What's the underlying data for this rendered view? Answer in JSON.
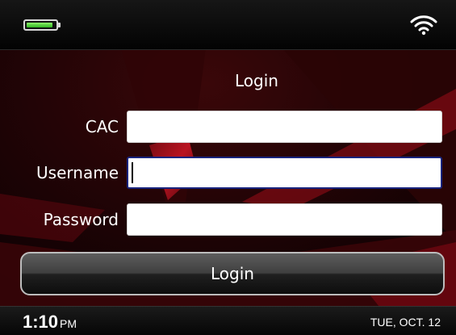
{
  "status_top": {
    "battery_level": 0.9,
    "icons": [
      "battery-icon",
      "wifi-icon"
    ]
  },
  "login_form": {
    "title": "Login",
    "fields": [
      {
        "label": "CAC",
        "value": ""
      },
      {
        "label": "Username",
        "value": ""
      },
      {
        "label": "Password",
        "value": ""
      }
    ],
    "focused_field": "Username",
    "button_label": "Login"
  },
  "status_bottom": {
    "time": "1:10",
    "ampm": "PM",
    "date": "TUE, OCT. 12"
  },
  "colors": {
    "background": "#120203",
    "accent_red": "#c81020",
    "focus_border": "#18237d",
    "battery_green": "#2fb522"
  }
}
